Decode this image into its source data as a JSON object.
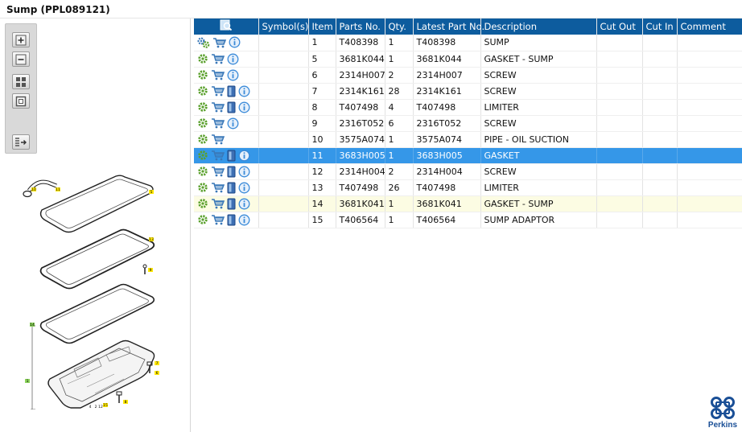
{
  "page": {
    "title": "Sump (PPL089121)"
  },
  "toolbar": {
    "buttons": [
      {
        "icon": "zoom-in-icon"
      },
      {
        "icon": "zoom-out-icon"
      },
      {
        "icon": "fit-grid-icon"
      },
      {
        "icon": "fit-page-icon"
      },
      {
        "icon": "export-list-icon"
      }
    ]
  },
  "table": {
    "columns": [
      "",
      "Symbol(s)",
      "Item",
      "Parts No.",
      "Qty.",
      "Latest Part No.",
      "Description",
      "Cut Out",
      "Cut In",
      "Comment"
    ],
    "rows": [
      {
        "item": "1",
        "part_no": "T408398",
        "qty": "1",
        "latest": "T408398",
        "desc": "SUMP",
        "icons": [
          "gears",
          "cart",
          "info"
        ],
        "state": "normal"
      },
      {
        "item": "5",
        "part_no": "3681K044",
        "qty": "1",
        "latest": "3681K044",
        "desc": "GASKET - SUMP",
        "icons": [
          "gear",
          "cart",
          "info"
        ],
        "state": "normal"
      },
      {
        "item": "6",
        "part_no": "2314H007",
        "qty": "2",
        "latest": "2314H007",
        "desc": "SCREW",
        "icons": [
          "gear",
          "cart",
          "info"
        ],
        "state": "normal"
      },
      {
        "item": "7",
        "part_no": "2314K161",
        "qty": "28",
        "latest": "2314K161",
        "desc": "SCREW",
        "icons": [
          "gear",
          "cart",
          "doc",
          "info"
        ],
        "state": "normal"
      },
      {
        "item": "8",
        "part_no": "T407498",
        "qty": "4",
        "latest": "T407498",
        "desc": "LIMITER",
        "icons": [
          "gear",
          "cart",
          "doc",
          "info"
        ],
        "state": "normal"
      },
      {
        "item": "9",
        "part_no": "2316T052",
        "qty": "6",
        "latest": "2316T052",
        "desc": "SCREW",
        "icons": [
          "gear",
          "cart",
          "info"
        ],
        "state": "normal"
      },
      {
        "item": "10",
        "part_no": "3575A074",
        "qty": "1",
        "latest": "3575A074",
        "desc": "PIPE - OIL SUCTION",
        "icons": [
          "gear",
          "cart"
        ],
        "state": "normal"
      },
      {
        "item": "11",
        "part_no": "3683H005",
        "qty": "1",
        "latest": "3683H005",
        "desc": "GASKET",
        "icons": [
          "gear",
          "cart",
          "doc",
          "info"
        ],
        "state": "selected"
      },
      {
        "item": "12",
        "part_no": "2314H004",
        "qty": "2",
        "latest": "2314H004",
        "desc": "SCREW",
        "icons": [
          "gear",
          "cart",
          "doc",
          "info"
        ],
        "state": "normal"
      },
      {
        "item": "13",
        "part_no": "T407498",
        "qty": "26",
        "latest": "T407498",
        "desc": "LIMITER",
        "icons": [
          "gear",
          "cart",
          "doc",
          "info"
        ],
        "state": "normal"
      },
      {
        "item": "14",
        "part_no": "3681K041",
        "qty": "1",
        "latest": "3681K041",
        "desc": "GASKET - SUMP",
        "icons": [
          "gear",
          "cart",
          "doc",
          "info"
        ],
        "state": "highlight"
      },
      {
        "item": "15",
        "part_no": "T406564",
        "qty": "1",
        "latest": "T406564",
        "desc": "SUMP ADAPTOR",
        "icons": [
          "gear",
          "cart",
          "doc",
          "info"
        ],
        "state": "normal"
      }
    ]
  },
  "diagram": {
    "callouts": [
      "10",
      "11",
      "5",
      "13",
      "9",
      "14",
      "1",
      "7",
      "6",
      "8",
      "15",
      "4",
      "2",
      "12"
    ]
  },
  "logo": {
    "text": "Perkins"
  },
  "colors": {
    "header": "#0d5c9e",
    "selected": "#3597e8",
    "highlight": "#fcfce3",
    "gear": "#5aa02c",
    "cart": "#3a78b8",
    "info": "#3a8ad8"
  }
}
